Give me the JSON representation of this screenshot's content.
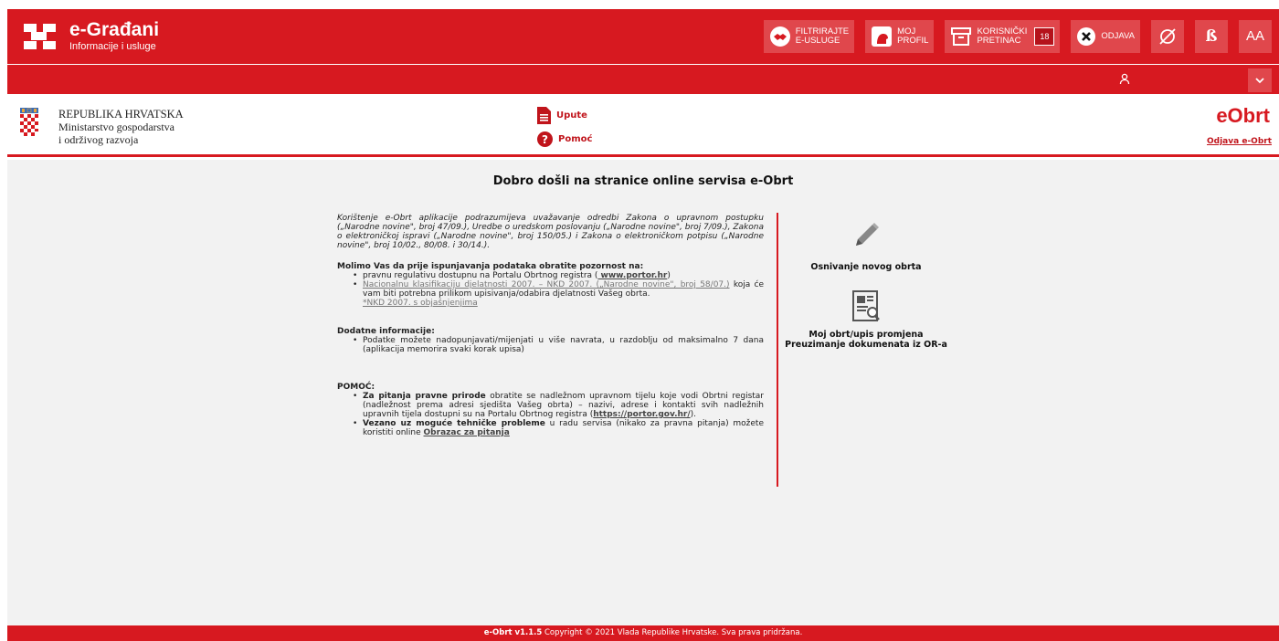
{
  "topbar": {
    "brand_title": "e-Građani",
    "brand_subtitle": "Informacije i usluge",
    "filter_line1": "FILTRIRAJTE",
    "filter_line2": "E-USLUGE",
    "profile_line1": "MOJ",
    "profile_line2": "PROFIL",
    "inbox_line1": "KORISNIČKI",
    "inbox_line2": "PRETINAC",
    "inbox_count": "18",
    "logout_label": "ODJAVA",
    "font_toggle_label": "ß",
    "text_size_label": "AA",
    "icons": [
      "handshake-icon",
      "profile-icon",
      "inbox-icon",
      "close-icon",
      "eye-off-icon",
      "chevron-down-icon",
      "user-icon"
    ]
  },
  "header": {
    "ministry_line1": "REPUBLIKA HRVATSKA",
    "ministry_line2": "Ministarstvo gospodarstva",
    "ministry_line3": "i održivog razvoja",
    "upute_label": "Upute",
    "pomoc_label": "Pomoć",
    "app_title": "eObrt",
    "logout_link": "Odjava e-Obrt"
  },
  "main": {
    "welcome": "Dobro došli na stranice online servisa e-Obrt",
    "intro": "Korištenje e-Obrt aplikacije podrazumijeva uvažavanje odredbi Zakona o upravnom postupku („Narodne novine\", broj 47/09.), Uredbe o uredskom poslovanju („Narodne novine\", broj 7/09.), Zakona o elektroničkoj ispravi („Narodne novine\", broj 150/05.) i Zakona o elektroničkom potpisu („Narodne novine\", broj 10/02., 80/08. i 30/14.).",
    "attention_title": "Molimo Vas da prije ispunjavanja podataka obratite pozornost na:",
    "attention_item1_text": "pravnu regulativu dostupnu na Portalu Obrtnog registra (",
    "attention_item1_link": " www.portor.hr",
    "attention_item1_end": ")",
    "attention_item2_link": "Nacionalnu klasifikaciju djelatnosti 2007. – NKD 2007. („Narodne novine\", broj 58/07.)",
    "attention_item2_text": " koja će vam biti potrebna prilikom upisivanja/odabira djelatnosti Vašeg obrta.",
    "attention_item2_link2": "*NKD 2007. s objašnjenjima",
    "additional_title": "Dodatne informacije:",
    "additional_item1": "Podatke možete nadopunjavati/mijenjati u više navrata, u razdoblju od maksimalno 7 dana (aplikacija memorira svaki korak upisa)",
    "help_title": "POMOĆ:",
    "help_item1_bold": "Za pitanja pravne prirode",
    "help_item1_text": " obratite se nadležnom upravnom tijelu koje vodi Obrtni registar (nadležnost prema adresi sjedišta Vašeg obrta) – nazivi, adrese i kontakti svih nadležnih upravnih tijela dostupni su na Portalu Obrtnog registra (",
    "help_item1_link": "https://portor.gov.hr/",
    "help_item1_end": ").",
    "help_item2_bold": "Vezano uz moguće tehničke probleme",
    "help_item2_text": " u radu servisa (nikako za pravna pitanja) možete koristiti online ",
    "help_item2_link": "Obrazac za pitanja",
    "option1_label": "Osnivanje novog obrta",
    "option2_label": "Moj obrt/upis promjena Preuzimanje dokumenata iz OR-a"
  },
  "footer": {
    "version": "e-Obrt v1.1.5",
    "copyright": " Copyright © 2021 Vlada Republike Hrvatske. Sva prava pridržana."
  },
  "colors": {
    "brand_red": "#d71920",
    "button_red": "#e0474c",
    "background": "#f2f2f2"
  }
}
